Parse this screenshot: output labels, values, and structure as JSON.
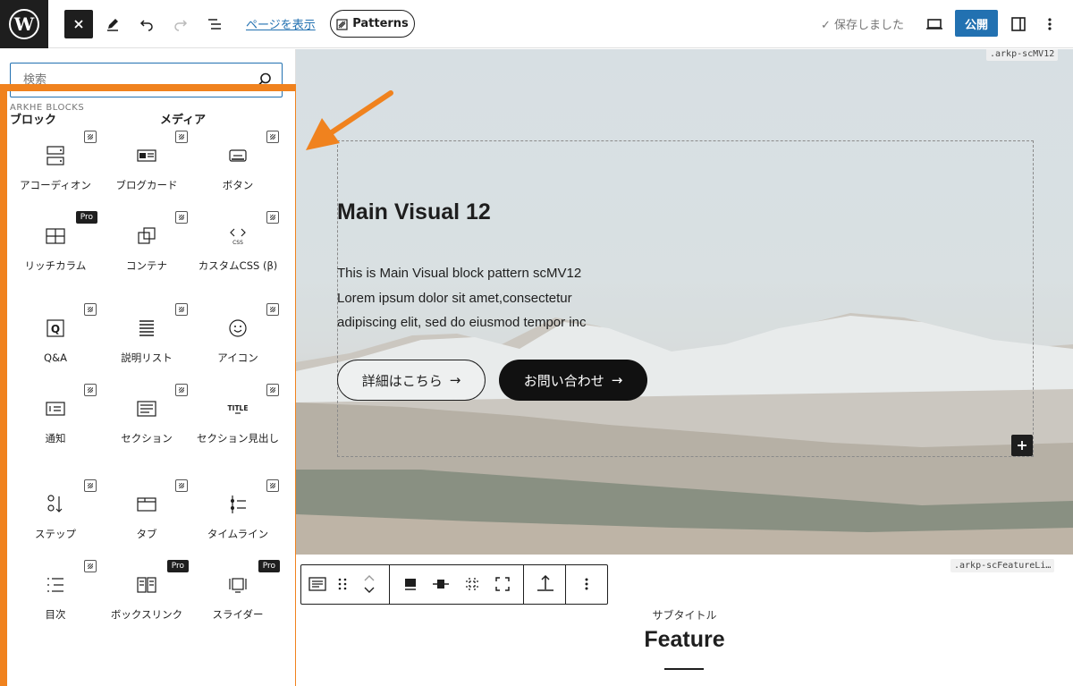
{
  "topbar": {
    "view_page_link": "ページを表示",
    "patterns_label": "Patterns",
    "saved_status": "✓ 保存しました",
    "publish_label": "公開"
  },
  "sidebar": {
    "search_placeholder": "検索",
    "tabs": [
      "ブロック",
      "メディア"
    ],
    "category_title": "ARKHE BLOCKS",
    "blocks": [
      {
        "label": "アコーディオン",
        "icon": "accordion-icon",
        "badge": "ext"
      },
      {
        "label": "ブログカード",
        "icon": "blog-card-icon",
        "badge": "ext"
      },
      {
        "label": "ボタン",
        "icon": "button-icon",
        "badge": "ext"
      },
      {
        "label": "リッチカラム",
        "icon": "columns-icon",
        "badge": "Pro"
      },
      {
        "label": "コンテナ",
        "icon": "container-icon",
        "badge": "ext"
      },
      {
        "label": "カスタムCSS (β)",
        "icon": "css-icon",
        "badge": "ext"
      },
      {
        "label": "Q&A",
        "icon": "faq-icon",
        "badge": "ext"
      },
      {
        "label": "説明リスト",
        "icon": "description-list-icon",
        "badge": "ext"
      },
      {
        "label": "アイコン",
        "icon": "smiley-icon",
        "badge": "ext"
      },
      {
        "label": "通知",
        "icon": "notice-icon",
        "badge": "ext"
      },
      {
        "label": "セクション",
        "icon": "section-icon",
        "badge": "ext"
      },
      {
        "label": "セクション見出し",
        "icon": "title-icon",
        "badge": "ext"
      },
      {
        "label": "ステップ",
        "icon": "step-icon",
        "badge": "ext"
      },
      {
        "label": "タブ",
        "icon": "tab-icon",
        "badge": "ext"
      },
      {
        "label": "タイムライン",
        "icon": "timeline-icon",
        "badge": "ext"
      },
      {
        "label": "目次",
        "icon": "toc-icon",
        "badge": "ext"
      },
      {
        "label": "ボックスリンク",
        "icon": "box-links-icon",
        "badge": "Pro"
      },
      {
        "label": "スライダー",
        "icon": "slider-icon",
        "badge": "Pro"
      }
    ]
  },
  "canvas": {
    "tag_top": ".arkp-scMV12",
    "tag_feature": ".arkp-scFeatureLi…",
    "hero_title": "Main Visual 12",
    "hero_lines": [
      "This is Main Visual block pattern scMV12",
      "Lorem ipsum dolor sit amet,consectetur",
      "adipiscing elit, sed do eiusmod tempor inc"
    ],
    "btn_detail": "詳細はこちら",
    "btn_contact": "お問い合わせ",
    "subtitle": "サブタイトル",
    "feature_title": "Feature"
  },
  "colors": {
    "accent_orange": "#f0821e",
    "publish_blue": "#2271b1",
    "wp_dark": "#1e1e1e"
  }
}
